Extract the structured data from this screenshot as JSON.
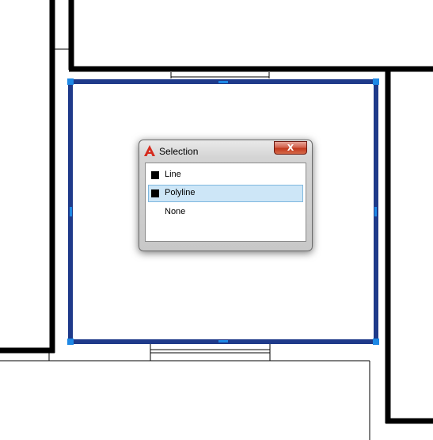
{
  "dialog": {
    "title": "Selection",
    "close_label": "X",
    "app_icon": "autocad-logo-icon",
    "items": [
      {
        "label": "Line",
        "swatch_color": "#000000",
        "selected": false
      },
      {
        "label": "Polyline",
        "swatch_color": "#000000",
        "selected": true
      },
      {
        "label": "None",
        "swatch_color": null,
        "selected": false
      }
    ]
  },
  "colors": {
    "wall": "#000000",
    "selected_polyline": "#1f3a8a",
    "grip": "#1e88e5",
    "selection_highlight": "#cde6f7",
    "close_button": "#c2391f"
  }
}
